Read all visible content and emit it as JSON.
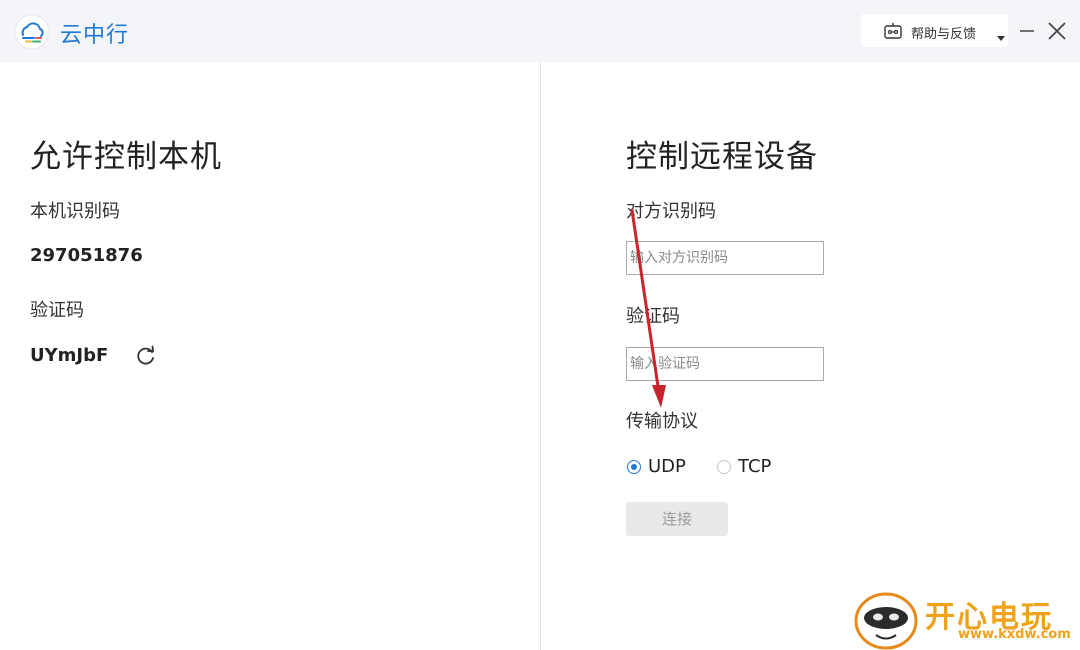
{
  "window": {
    "app_title": "云中行",
    "help_label": "帮助与反馈"
  },
  "left_panel": {
    "heading": "允许控制本机",
    "device_id_label": "本机识别码",
    "device_id_value": "297051876",
    "verify_label": "验证码",
    "verify_value": "UYmJbF"
  },
  "right_panel": {
    "heading": "控制远程设备",
    "peer_id_label": "对方识别码",
    "peer_id_placeholder": "输入对方识别码",
    "verify_label": "验证码",
    "verify_placeholder": "输入验证码",
    "protocol_label": "传输协议",
    "protocols": [
      {
        "label": "UDP",
        "selected": true
      },
      {
        "label": "TCP",
        "selected": false
      }
    ],
    "connect_label": "连接"
  },
  "watermark": {
    "brand": "开心电玩",
    "url": "www.kxdw.com"
  },
  "colors": {
    "accent": "#1f7ad6",
    "annotation_arrow": "#c8242b",
    "watermark": "#f0a21a"
  }
}
